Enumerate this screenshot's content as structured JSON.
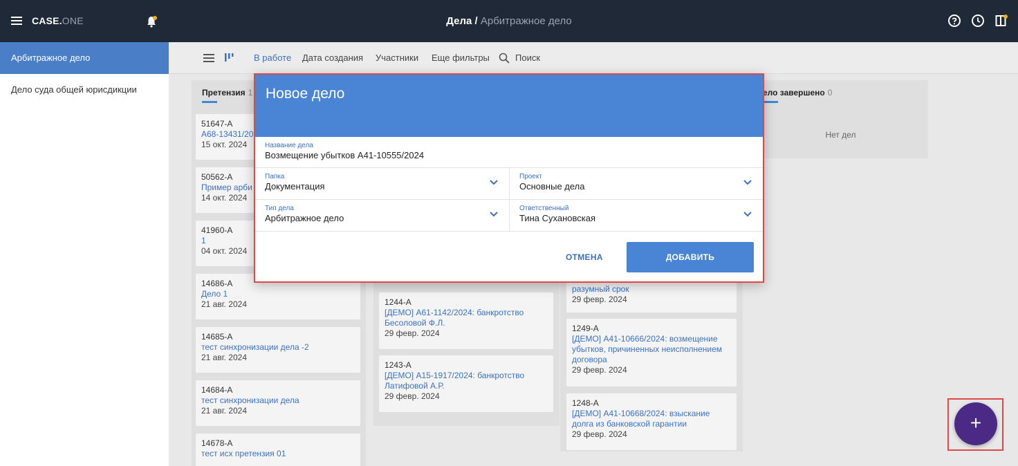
{
  "topbar": {
    "logo_main": "CASE.",
    "logo_suffix": "ONE",
    "title_main": "Дела",
    "title_sep": " / ",
    "title_sub": "Арбитражное дело",
    "icons": [
      "menu-icon",
      "bell-icon",
      "help-icon",
      "history-icon",
      "panel-icon"
    ]
  },
  "sidebar": {
    "items": [
      {
        "label": "Арбитражное дело",
        "active": true
      },
      {
        "label": "Дело суда общей юрисдикции",
        "active": false
      }
    ]
  },
  "filters": {
    "in_work": "В работе",
    "created": "Дата создания",
    "participants": "Участники",
    "more": "Еще фильтры",
    "search": "Поиск"
  },
  "columns": [
    {
      "title": "Претензия",
      "count": "1",
      "cards": [
        {
          "num": "51647-А",
          "title": "А68-13431/20",
          "date": "15 окт. 2024"
        },
        {
          "num": "50562-А",
          "title": "Пример арби",
          "date": "14 окт. 2024"
        },
        {
          "num": "41960-А",
          "title": "1",
          "date": "04 окт. 2024"
        },
        {
          "num": "14686-А",
          "title": "Дело 1",
          "date": "21 авг. 2024"
        },
        {
          "num": "14685-А",
          "title": "тест синхронизации дела -2",
          "date": "21 авг. 2024"
        },
        {
          "num": "14684-А",
          "title": "тест синхронизации дела",
          "date": "21 авг. 2024"
        },
        {
          "num": "14678-А",
          "title": "тест исх претензия 01",
          "date": ""
        }
      ]
    },
    {
      "title": "",
      "count": "",
      "cards": [
        {
          "num": "1244-А",
          "title": "[ДЕМО] А61-1142/2024: банкротство Бесоловой Ф.Л.",
          "date": "29 февр. 2024"
        },
        {
          "num": "1243-А",
          "title": "[ДЕМО] А15-1917/2024: банкротство Латифовой А.Р.",
          "date": "29 февр. 2024"
        }
      ]
    },
    {
      "title": "",
      "count": "",
      "cards": [
        {
          "num": "",
          "title": "разумный срок",
          "date": "29 февр. 2024"
        },
        {
          "num": "1249-А",
          "title": "[ДЕМО] А41-10666/2024: возмещение убытков, причиненных неисполнением договора",
          "date": "29 февр. 2024"
        },
        {
          "num": "1248-А",
          "title": "[ДЕМО] А41-10668/2024: взыскание долга из банковской гарантии",
          "date": "29 февр. 2024"
        }
      ]
    },
    {
      "title": "ело завершено",
      "count": "0",
      "empty": "Нет дел"
    }
  ],
  "modal": {
    "title": "Новое дело",
    "name_label": "Название дела",
    "name_value": "Возмещение убытков А41-10555/2024",
    "folder_label": "Папка",
    "folder_value": "Документация",
    "project_label": "Проект",
    "project_value": "Основные дела",
    "type_label": "Тип дела",
    "type_value": "Арбитражное дело",
    "owner_label": "Ответственный",
    "owner_value": "Тина Сухановская",
    "cancel": "ОТМЕНА",
    "add": "ДОБАВИТЬ"
  },
  "fab": {
    "label": "+"
  },
  "colors": {
    "accent": "#4a84d4",
    "topbar": "#1f2937",
    "fab": "#4b2a86",
    "highlight": "#e04848"
  }
}
